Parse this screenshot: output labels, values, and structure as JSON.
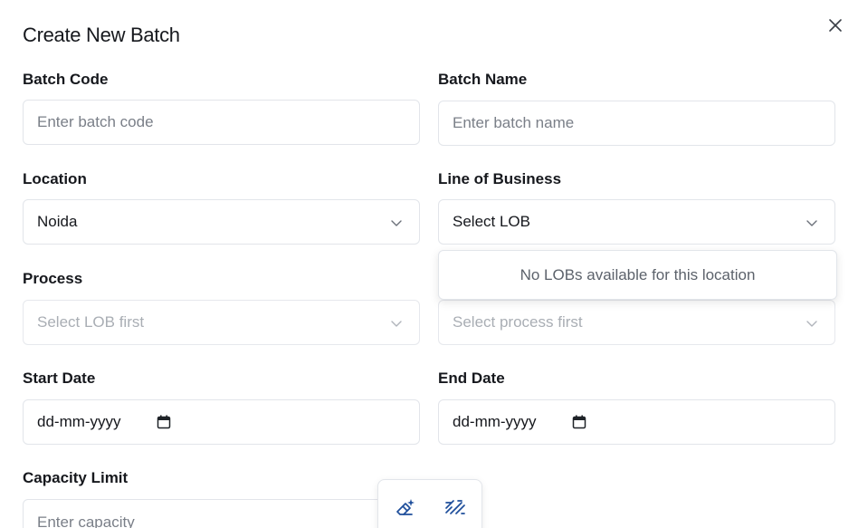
{
  "dialog": {
    "title": "Create New Batch",
    "close_icon": "close-icon"
  },
  "fields": {
    "batch_code": {
      "label": "Batch Code",
      "placeholder": "Enter batch code",
      "value": ""
    },
    "batch_name": {
      "label": "Batch Name",
      "placeholder": "Enter batch name",
      "value": ""
    },
    "location": {
      "label": "Location",
      "value": "Noida"
    },
    "line_of_business": {
      "label": "Line of Business",
      "value": "Select LOB"
    },
    "process": {
      "label": "Process",
      "value": "Select LOB first"
    },
    "process_sub": {
      "value": "Select process first"
    },
    "start_date": {
      "label": "Start Date",
      "value": "dd-mm-yyyy"
    },
    "end_date": {
      "label": "End Date",
      "value": "dd-mm-yyyy"
    },
    "capacity_limit": {
      "label": "Capacity Limit",
      "placeholder": "Enter capacity"
    }
  },
  "lob_dropdown": {
    "empty_message": "No LOBs available for this location"
  },
  "floating_toolbar": {
    "tools": [
      "magic-eraser-icon",
      "hatch-pattern-icon"
    ]
  },
  "colors": {
    "border": "#e2e5ea",
    "text": "#16181d",
    "placeholder": "#7a7f88",
    "accent": "#1e4e9b"
  }
}
